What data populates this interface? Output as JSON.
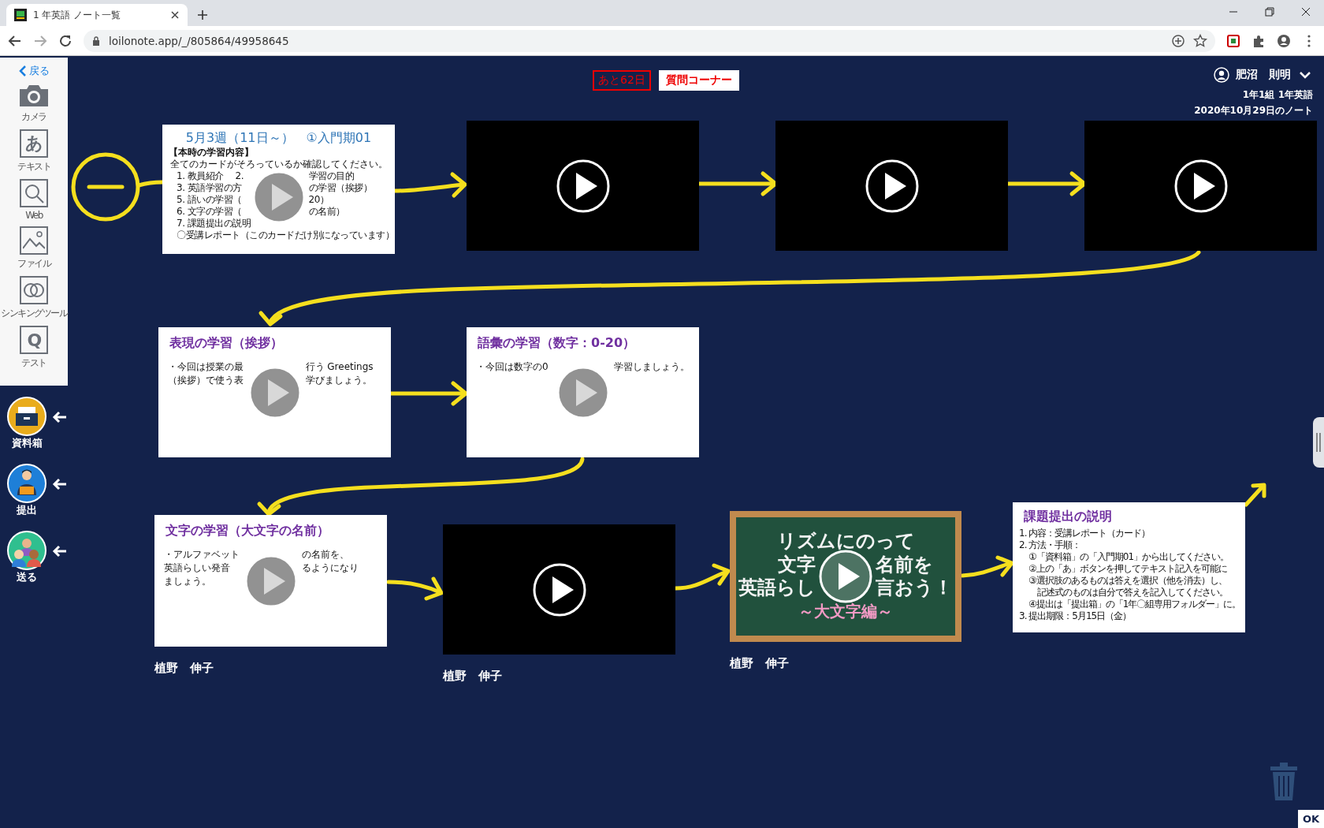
{
  "browser": {
    "tab_title": "1 年英語 ノート一覧",
    "url": "loilonote.app/_/805864/49958645"
  },
  "toolbar": {
    "back": "戻る",
    "tools": [
      {
        "kind": "camera",
        "label": "カメラ"
      },
      {
        "kind": "text",
        "glyph": "あ",
        "label": "テキスト"
      },
      {
        "kind": "web",
        "label": "Web"
      },
      {
        "kind": "file",
        "label": "ファイル"
      },
      {
        "kind": "thinking",
        "label": "シンキングツール"
      },
      {
        "kind": "test",
        "glyph": "Q",
        "label": "テスト"
      }
    ]
  },
  "trays": [
    {
      "kind": "box",
      "label": "資料箱"
    },
    {
      "kind": "submit",
      "label": "提出"
    },
    {
      "kind": "send",
      "label": "送る"
    }
  ],
  "header": {
    "countdown": "あと62日",
    "question_corner": "質問コーナー",
    "user": "肥沼　則明",
    "class_name": "1年1組 1年英語",
    "note_date": "2020年10月29日のノート"
  },
  "cards": [
    {
      "kind": "agenda",
      "playable": true,
      "title": "5月3週（11日～）　①入門期01",
      "heading": "【本時の学習内容】",
      "note": "全てのカードがそろっているか確認してください。",
      "lines": [
        [
          "1. 教員紹介　 2.",
          "学習の目的"
        ],
        [
          "3. 英語学習の方",
          "の学習（挨拶）"
        ],
        [
          "5. 語いの学習（",
          "20）"
        ],
        [
          "6. 文字の学習（",
          "の名前）"
        ],
        "7. 課題提出の説明",
        "〇受講レポート（このカードだけ別になっています）"
      ]
    },
    {
      "kind": "video",
      "playable": true
    },
    {
      "kind": "video",
      "playable": true
    },
    {
      "kind": "video",
      "playable": true
    },
    {
      "kind": "lesson",
      "playable": true,
      "title": "表現の学習（挨拶）",
      "lines": [
        [
          "・今回は授業の最",
          "行う Greetings"
        ],
        [
          "（挨拶）で使う表",
          "学びましょう。"
        ]
      ]
    },
    {
      "kind": "lesson",
      "playable": true,
      "title": "語彙の学習（数字：0-20）",
      "lines": [
        [
          "・今回は数字の0",
          "学習しましょう。"
        ]
      ]
    },
    {
      "kind": "lesson",
      "playable": true,
      "title": "文字の学習（大文字の名前）",
      "lines": [
        [
          "・アルファベット",
          "の名前を、"
        ],
        [
          "英語らしい発音",
          "るようになり"
        ],
        "ましょう。"
      ],
      "author": "植野　伸子"
    },
    {
      "kind": "video",
      "playable": true,
      "author": "植野　伸子"
    },
    {
      "kind": "chalkboard",
      "playable": true,
      "lines": [
        "リズムにのって",
        [
          "文字",
          "名前を"
        ],
        [
          "英語らし",
          "言おう！"
        ]
      ],
      "subtitle": "～大文字編～",
      "author": "植野　伸子"
    },
    {
      "kind": "assignment",
      "playable": false,
      "title": "課題提出の説明",
      "lines": [
        "1. 内容：受講レポート（カード）",
        "2. 方法・手順：",
        [
          "①「資料箱」の「入門期01」から出してください。",
          "②上の「あ」ボタンを押してテキスト記入を可能に",
          "③選択肢のあるものは答えを選択（他を消去）し、",
          "　記述式のものは自分で答えを記入してください。",
          "④提出は「提出箱」の「1年〇組専用フォルダー」に。"
        ],
        "3. 提出期限：5月15日（金）"
      ]
    }
  ],
  "ok_button": "OK"
}
